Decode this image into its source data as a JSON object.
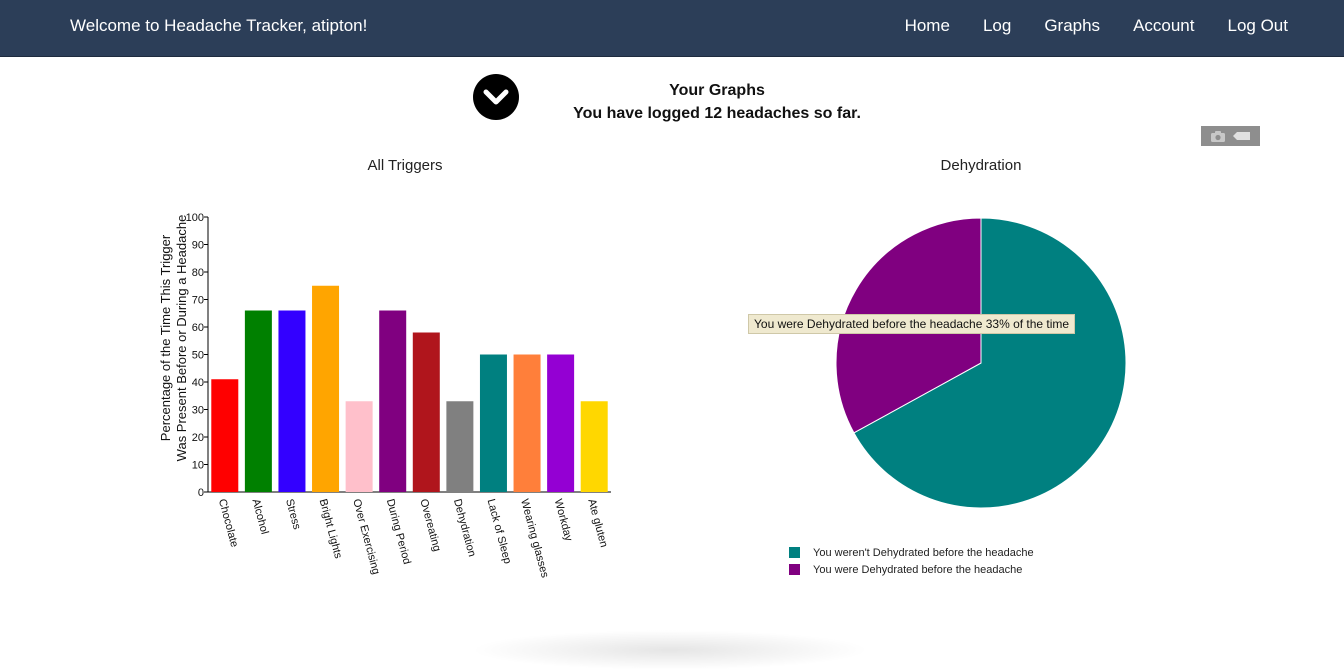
{
  "nav": {
    "brand": "Welcome to Headache Tracker, atipton!",
    "links": [
      "Home",
      "Log",
      "Graphs",
      "Account",
      "Log Out"
    ]
  },
  "header": {
    "title": "Your Graphs",
    "subtitle": "You have logged 12 headaches so far."
  },
  "toggle_icon": "chevron-down-icon",
  "modebar_icons": [
    "camera-icon",
    "tag-icon"
  ],
  "chart_data": [
    {
      "type": "bar",
      "title": "All Triggers",
      "xlabel": "",
      "ylabel": "Percentage of the Time This Trigger\nWas Present Before or During a Headache",
      "ylim": [
        0,
        100
      ],
      "yticks": [
        0,
        10,
        20,
        30,
        40,
        50,
        60,
        70,
        80,
        90,
        100
      ],
      "categories": [
        "Chocolate",
        "Alcohol",
        "Stress",
        "Bright Lights",
        "Over Exercising",
        "During Period",
        "Overeating",
        "Dehydration",
        "Lack of Sleep",
        "Wearing glasses",
        "Workday",
        "Ate gluten"
      ],
      "values": [
        41,
        66,
        66,
        75,
        33,
        66,
        58,
        33,
        50,
        50,
        50,
        33
      ],
      "colors": [
        "#ff0000",
        "#008000",
        "#3300ff",
        "#ffa500",
        "#ffc0cb",
        "#800080",
        "#b0151c",
        "#808080",
        "#008080",
        "#ff7f3a",
        "#9400d3",
        "#ffd700"
      ]
    },
    {
      "type": "pie",
      "title": "Dehydration",
      "labels": [
        "You weren't Dehydrated before the headache",
        "You were Dehydrated before the headache"
      ],
      "values": [
        67,
        33
      ],
      "colors": [
        "#008080",
        "#800080"
      ],
      "legend_position": "bottom",
      "tooltip": "You were Dehydrated before the headache 33% of the time"
    }
  ]
}
